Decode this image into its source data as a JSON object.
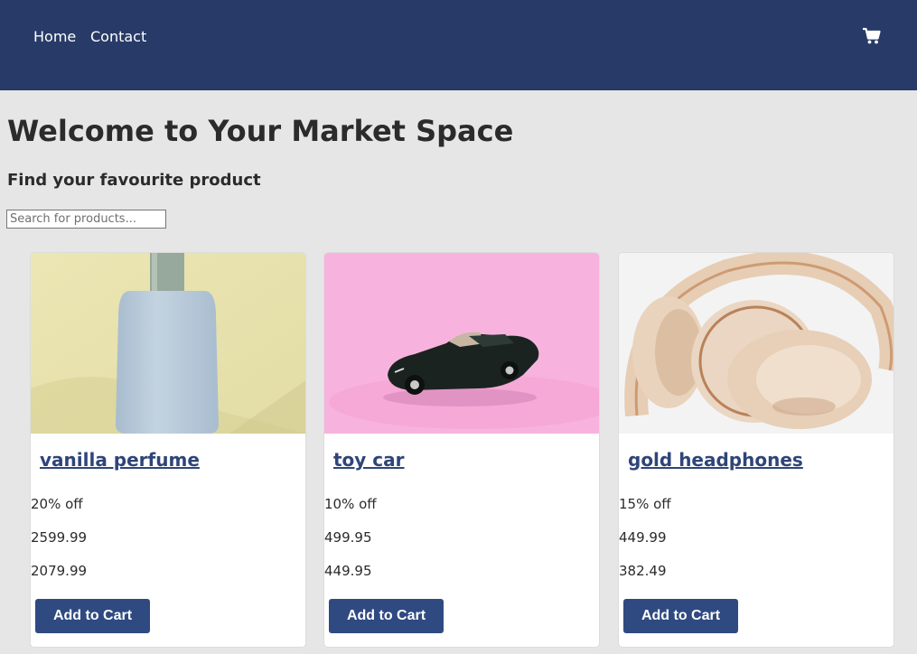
{
  "nav": {
    "home_label": "Home",
    "contact_label": "Contact",
    "cart_icon": "shopping-cart-icon"
  },
  "header": {
    "title": "Welcome to Your Market Space",
    "subtitle": "Find your favourite product"
  },
  "search": {
    "placeholder": "Search for products..."
  },
  "products": [
    {
      "name": "vanilla perfume",
      "discount": "20% off",
      "price": "2599.99",
      "sale_price": "2079.99",
      "button_label": "Add to Cart"
    },
    {
      "name": "toy car",
      "discount": "10% off",
      "price": "499.95",
      "sale_price": "449.95",
      "button_label": "Add to Cart"
    },
    {
      "name": "gold headphones",
      "discount": "15% off",
      "price": "449.99",
      "sale_price": "382.49",
      "button_label": "Add to Cart"
    }
  ],
  "colors": {
    "navbar": "#283b68",
    "page_background": "#e6e6e6",
    "button": "#2f4a80",
    "product_link": "#2f4578"
  }
}
